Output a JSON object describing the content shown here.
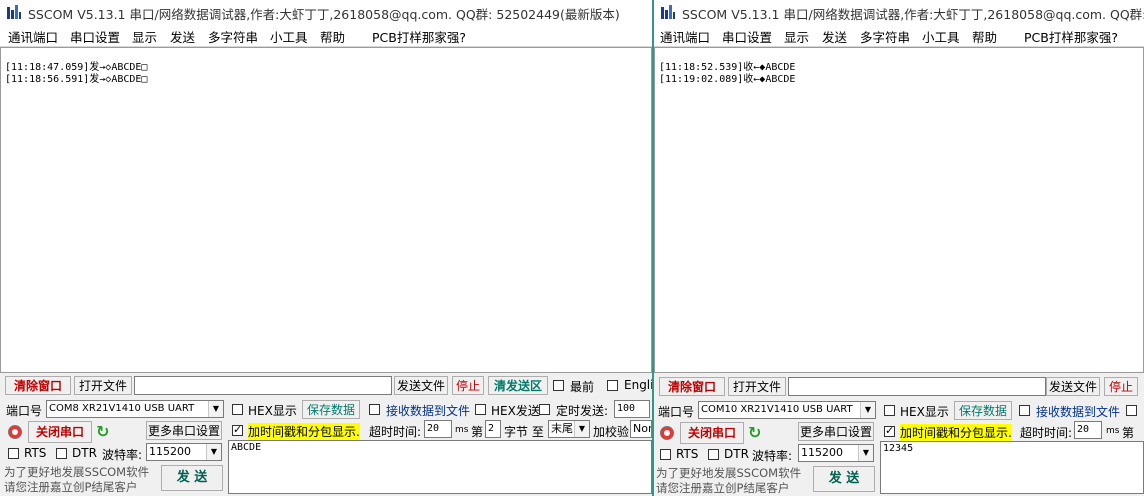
{
  "title": "SSCOM V5.13.1 串口/网络数据调试器,作者:大虾丁丁,2618058@qq.com. QQ群: 52502449(最新版本)",
  "menu": [
    "通讯端口",
    "串口设置",
    "显示",
    "发送",
    "多字符串",
    "小工具",
    "帮助",
    "PCB打样那家强?"
  ],
  "windows": [
    {
      "log": [
        "[11:18:47.059]发→◇ABCDE□",
        "[11:18:56.591]发→◇ABCDE□"
      ],
      "clear_btn": "清除窗口",
      "open_file_btn": "打开文件",
      "send_file_btn": "发送文件",
      "stop_btn": "停止",
      "clear_send_btn": "清发送区",
      "front_label": "最前",
      "english_label": "English",
      "port_label": "端口号",
      "port_value": "COM8 XR21V1410 USB UART",
      "hex_display": "HEX显示",
      "save_data": "保存数据",
      "recv_to_file": "接收数据到文件",
      "hex_send": "HEX发送",
      "timed_send": "定时发送:",
      "timed_value": "100",
      "close_port": "关闭串口",
      "more_settings": "更多串口设置",
      "timestamp": "加时间戳和分包显示.",
      "timeout_label": "超时时间:",
      "timeout_value": "20",
      "ms": "ms",
      "nth": "第",
      "byte_value": "2",
      "byte_to": "字节 至",
      "tail_value": "末尾",
      "checksum": "加校验",
      "checksum_value": "None",
      "rts": "RTS",
      "dtr": "DTR",
      "baud_label": "波特率:",
      "baud_value": "115200",
      "send_text": "ABCDE",
      "promo1": "为了更好地发展SSCOM软件",
      "promo2": "请您注册嘉立创P结尾客户",
      "send_btn": "发 送"
    },
    {
      "log": [
        "[11:18:52.539]收←◆ABCDE",
        "[11:19:02.089]收←◆ABCDE"
      ],
      "clear_btn": "清除窗口",
      "open_file_btn": "打开文件",
      "send_file_btn": "发送文件",
      "stop_btn": "停止",
      "port_label": "端口号",
      "port_value": "COM10 XR21V1410 USB UART",
      "hex_display": "HEX显示",
      "save_data": "保存数据",
      "recv_to_file": "接收数据到文件",
      "close_port": "关闭串口",
      "more_settings": "更多串口设置",
      "timestamp": "加时间戳和分包显示.",
      "timeout_label": "超时时间:",
      "timeout_value": "20",
      "ms": "ms",
      "nth": "第",
      "rts": "RTS",
      "dtr": "DTR",
      "baud_label": "波特率:",
      "baud_value": "115200",
      "send_text": "12345",
      "promo1": "为了更好地发展SSCOM软件",
      "promo2": "请您注册嘉立创P结尾客户",
      "send_btn": "发 送"
    }
  ]
}
